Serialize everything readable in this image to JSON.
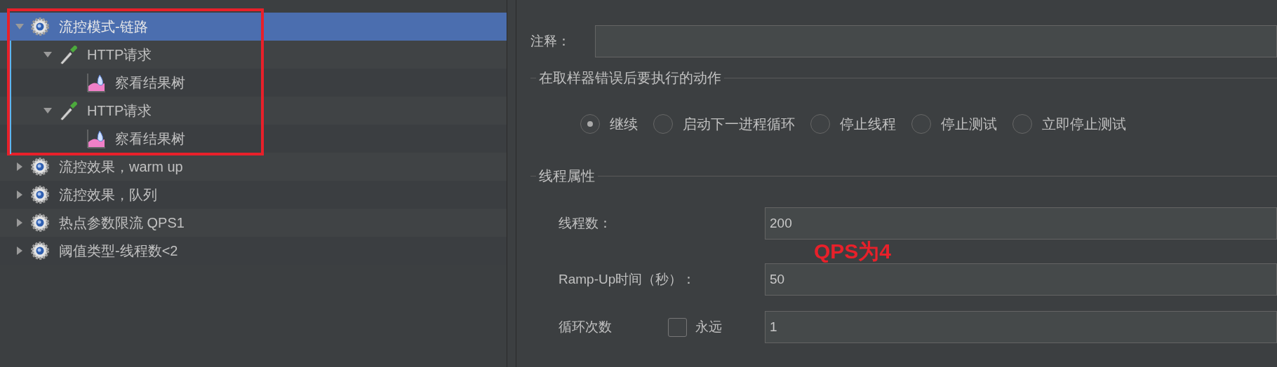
{
  "tree": {
    "items": [
      {
        "kind": "thread-group",
        "label": "流控模式-链路",
        "expanded": true,
        "selected": true,
        "children": [
          {
            "kind": "sampler",
            "label": "HTTP请求",
            "expanded": true,
            "selected": false,
            "children": [
              {
                "kind": "listener",
                "label": "察看结果树",
                "selected": false
              }
            ]
          },
          {
            "kind": "sampler",
            "label": "HTTP请求",
            "expanded": true,
            "selected": false,
            "children": [
              {
                "kind": "listener",
                "label": "察看结果树",
                "selected": false
              }
            ]
          }
        ]
      },
      {
        "kind": "thread-group",
        "label": "流控效果，warm up",
        "expanded": false,
        "selected": false
      },
      {
        "kind": "thread-group",
        "label": "流控效果，队列",
        "expanded": false,
        "selected": false
      },
      {
        "kind": "thread-group",
        "label": "热点参数限流 QPS1",
        "expanded": false,
        "selected": false
      },
      {
        "kind": "thread-group",
        "label": "阈值类型-线程数<2",
        "expanded": false,
        "selected": false
      }
    ]
  },
  "form": {
    "comment": {
      "label": "注释："
    },
    "error_action": {
      "title": "在取样器错误后要执行的动作",
      "options": [
        {
          "label": "继续",
          "selected": true
        },
        {
          "label": "启动下一进程循环",
          "selected": false
        },
        {
          "label": "停止线程",
          "selected": false
        },
        {
          "label": "停止测试",
          "selected": false
        },
        {
          "label": "立即停止测试",
          "selected": false
        }
      ]
    },
    "thread_properties": {
      "title": "线程属性",
      "threads": {
        "label": "线程数：",
        "value": "200"
      },
      "ramp_up": {
        "label": "Ramp-Up时间（秒）：",
        "value": "50"
      },
      "loop": {
        "label": "循环次数",
        "forever": {
          "label": "永远",
          "checked": false
        },
        "value": "1"
      }
    }
  },
  "annotations": [
    {
      "kind": "box"
    },
    {
      "kind": "text",
      "text": "QPS为4"
    }
  ]
}
